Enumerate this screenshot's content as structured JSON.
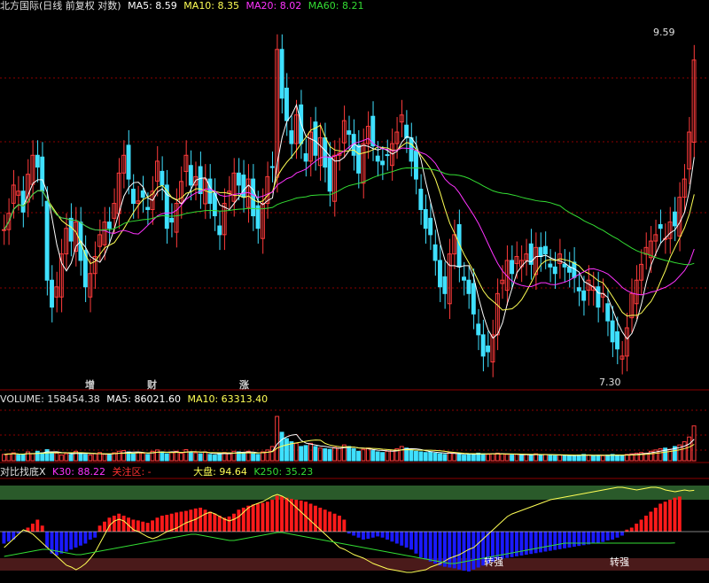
{
  "main_header": {
    "title": "北方国际(日线 前复权 对数)",
    "ma5": "MA5: 8.59",
    "ma10": "MA10: 8.35",
    "ma20": "MA20: 8.02",
    "ma60": "MA60: 8.21"
  },
  "volume_header": {
    "volume": "VOLUME: 158454.38",
    "ma5": "MA5: 86021.60",
    "ma10": "MA10: 63313.40"
  },
  "indicator_header": {
    "name": "对比找底X",
    "k30": "K30: 88.22",
    "focus": "关注区: -",
    "dapan": "大盘: 94.64",
    "k250": "K250: 35.23"
  },
  "price_labels": {
    "high": "9.59",
    "low": "7.30"
  },
  "event_markers": [
    {
      "text": "增",
      "color": "#ff3030"
    },
    {
      "text": "财",
      "color": "#4aa3ff"
    },
    {
      "text": "涨",
      "color": "#ff3030"
    }
  ],
  "signal_labels": [
    "转强",
    "转强"
  ],
  "colors": {
    "up": "#ff3b3b",
    "down": "#3fe0ff",
    "ma5": "#ffffff",
    "ma10": "#ffff55",
    "ma20": "#ff33ff",
    "ma60": "#33dd33",
    "grid": "#8b0000",
    "bar_pos": "#ff1a1a",
    "bar_neg": "#1a1aff"
  },
  "chart_data": [
    {
      "type": "candlestick",
      "title": "北方国际(日线 前复权 对数)",
      "scale": "log",
      "ylim": [
        7.3,
        9.59
      ],
      "grid": "dotted horizontal",
      "closes": [
        7.99,
        8.12,
        8.35,
        8.3,
        8.13,
        8.44,
        8.6,
        8.5,
        8.3,
        7.6,
        7.4,
        7.55,
        7.8,
        8.0,
        7.9,
        8.05,
        7.75,
        7.55,
        7.65,
        7.78,
        7.95,
        8.05,
        8.0,
        8.2,
        8.45,
        8.6,
        8.4,
        8.2,
        8.22,
        8.25,
        8.15,
        8.3,
        8.55,
        8.35,
        8.0,
        8.05,
        8.2,
        8.38,
        8.6,
        8.35,
        8.42,
        8.28,
        8.4,
        8.2,
        8.1,
        7.95,
        8.2,
        8.3,
        8.45,
        8.35,
        8.25,
        8.4,
        8.1,
        8.0,
        8.2,
        8.42,
        8.5,
        9.55,
        9.1,
        8.9,
        8.7,
        8.95,
        8.7,
        8.55,
        8.8,
        8.6,
        8.75,
        8.5,
        8.3,
        8.6,
        8.62,
        8.9,
        8.78,
        8.6,
        8.45,
        8.7,
        8.85,
        8.68,
        8.55,
        8.52,
        8.6,
        8.7,
        8.8,
        8.95,
        8.75,
        8.55,
        8.4,
        8.15,
        8.0,
        7.95,
        7.75,
        7.55,
        7.5,
        7.8,
        7.95,
        7.7,
        7.6,
        7.5,
        7.35,
        7.2,
        7.05,
        7.08,
        7.2,
        7.5,
        7.6,
        7.75,
        7.65,
        7.78,
        7.75,
        7.8,
        7.72,
        7.85,
        7.78,
        7.8,
        7.7,
        7.65,
        7.8,
        7.7,
        7.66,
        7.62,
        7.52,
        7.45,
        7.6,
        7.55,
        7.4,
        7.5,
        7.3,
        7.15,
        7.1,
        7.05,
        7.25,
        7.5,
        7.6,
        7.72,
        7.85,
        7.9,
        7.95,
        8.0,
        7.92,
        8.05,
        8.02,
        8.25,
        8.4,
        8.8,
        9.45
      ]
    },
    {
      "type": "bar",
      "title": "VOLUME",
      "series": [
        {
          "name": "VOLUME",
          "values": [
            20,
            22,
            25,
            18,
            20,
            28,
            22,
            30,
            25,
            35,
            28,
            24,
            18,
            22,
            20,
            30,
            25,
            20,
            18,
            22,
            26,
            20,
            18,
            25,
            30,
            32,
            28,
            22,
            26,
            24,
            20,
            30,
            34,
            28,
            22,
            26,
            30,
            24,
            35,
            28,
            25,
            22,
            28,
            20,
            18,
            22,
            26,
            24,
            30,
            28,
            26,
            30,
            22,
            20,
            28,
            34,
            45,
            140,
            90,
            70,
            60,
            55,
            45,
            48,
            55,
            45,
            40,
            38,
            36,
            42,
            40,
            50,
            45,
            38,
            30,
            36,
            40,
            32,
            28,
            26,
            30,
            34,
            38,
            45,
            40,
            34,
            30,
            28,
            26,
            28,
            24,
            22,
            20,
            26,
            24,
            20,
            18,
            20,
            22,
            24,
            22,
            20,
            22,
            24,
            22,
            20,
            18,
            20,
            18,
            20,
            18,
            22,
            18,
            20,
            18,
            16,
            18,
            16,
            17,
            16,
            18,
            20,
            18,
            16,
            17,
            16,
            18,
            20,
            18,
            16,
            20,
            22,
            24,
            26,
            24,
            30,
            34,
            38,
            40,
            36,
            45,
            50,
            60,
            75,
            110
          ]
        }
      ]
    },
    {
      "type": "bar",
      "title": "对比找底X",
      "series": [
        {
          "name": "K30",
          "values": [
            -30,
            -25,
            -20,
            -5,
            0,
            10,
            20,
            30,
            15,
            -40,
            -55,
            -60,
            -55,
            -50,
            -45,
            -40,
            -35,
            -30,
            -20,
            -15,
            15,
            25,
            35,
            40,
            45,
            40,
            35,
            30,
            28,
            25,
            22,
            28,
            35,
            40,
            42,
            45,
            48,
            50,
            52,
            55,
            58,
            60,
            55,
            50,
            45,
            40,
            35,
            38,
            45,
            55,
            60,
            65,
            68,
            70,
            72,
            75,
            80,
            90,
            88,
            85,
            82,
            80,
            78,
            75,
            70,
            65,
            60,
            55,
            50,
            45,
            40,
            30,
            -5,
            -10,
            -15,
            -20,
            -18,
            -15,
            -12,
            -15,
            -20,
            -25,
            -30,
            -35,
            -40,
            -45,
            -55,
            -65,
            -70,
            -75,
            -80,
            -85,
            -88,
            -90,
            -92,
            -95,
            -98,
            -100,
            -95,
            -90,
            -85,
            -80,
            -75,
            -70,
            -68,
            -66,
            -64,
            -62,
            -60,
            -58,
            -56,
            -54,
            -52,
            -50,
            -48,
            -46,
            -44,
            -42,
            -40,
            -38,
            -36,
            -34,
            -32,
            -30,
            -28,
            -26,
            -22,
            -20,
            -15,
            -10,
            5,
            10,
            20,
            30,
            40,
            50,
            60,
            70,
            75,
            80,
            85,
            88
          ]
        },
        {
          "name": "大盘",
          "values": [
            30,
            35,
            40,
            45,
            50,
            48,
            45,
            40,
            35,
            30,
            25,
            20,
            15,
            10,
            8,
            5,
            8,
            12,
            18,
            25,
            35,
            45,
            55,
            60,
            62,
            60,
            55,
            50,
            48,
            45,
            42,
            40,
            42,
            45,
            48,
            50,
            52,
            55,
            58,
            60,
            62,
            65,
            68,
            70,
            68,
            65,
            62,
            60,
            62,
            65,
            70,
            75,
            78,
            80,
            82,
            85,
            88,
            90,
            88,
            85,
            80,
            75,
            70,
            65,
            60,
            55,
            50,
            45,
            40,
            35,
            30,
            28,
            25,
            22,
            20,
            18,
            15,
            12,
            10,
            8,
            6,
            5,
            4,
            3,
            2,
            2,
            3,
            4,
            5,
            8,
            10,
            12,
            15,
            18,
            20,
            22,
            25,
            28,
            30,
            35,
            40,
            45,
            50,
            55,
            60,
            65,
            68,
            70,
            72,
            74,
            76,
            78,
            80,
            82,
            84,
            85,
            86,
            87,
            88,
            89,
            90,
            91,
            92,
            93,
            94,
            95,
            96,
            97,
            98,
            98,
            97,
            96,
            95,
            96,
            97,
            98,
            98,
            97,
            95,
            94,
            93,
            94,
            95,
            94,
            94.64
          ]
        },
        {
          "name": "K250",
          "values": [
            20,
            21,
            22,
            23,
            24,
            25,
            26,
            27,
            28,
            28,
            27,
            26,
            25,
            24,
            23,
            22,
            22,
            23,
            24,
            25,
            26,
            27,
            28,
            29,
            30,
            31,
            32,
            33,
            34,
            35,
            36,
            37,
            38,
            39,
            40,
            41,
            42,
            43,
            44,
            45,
            45,
            44,
            43,
            42,
            41,
            40,
            39,
            38,
            38,
            39,
            40,
            41,
            42,
            43,
            44,
            45,
            46,
            47,
            47,
            46,
            45,
            44,
            43,
            42,
            41,
            40,
            39,
            38,
            37,
            36,
            35,
            34,
            33,
            32,
            31,
            30,
            29,
            28,
            27,
            26,
            25,
            24,
            23,
            22,
            21,
            20,
            19,
            18,
            17,
            16,
            15,
            14,
            13,
            12,
            12,
            13,
            14,
            15,
            16,
            17,
            18,
            19,
            20,
            21,
            22,
            23,
            24,
            25,
            26,
            27,
            28,
            29,
            30,
            31,
            32,
            33,
            34,
            35,
            35,
            35,
            35,
            35,
            35,
            35,
            35,
            35,
            35,
            35,
            35,
            35,
            35,
            35,
            35,
            35,
            35,
            35,
            35,
            35,
            35,
            35,
            35.23
          ]
        }
      ]
    }
  ]
}
